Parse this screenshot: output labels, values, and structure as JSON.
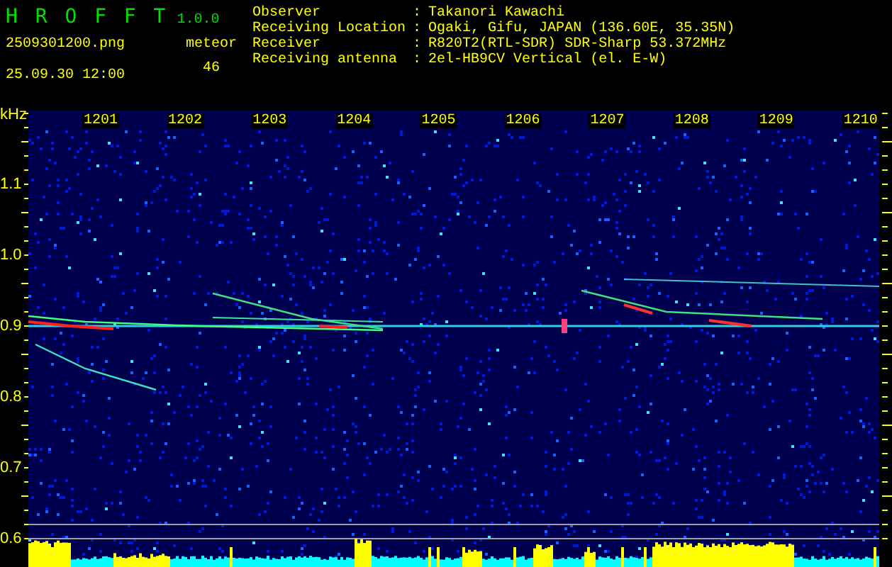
{
  "app": {
    "name": "H R O F F T",
    "version": "1.0.0"
  },
  "file": "2509301200.png",
  "datetime": "25.09.30 12:00",
  "count": {
    "label": "meteor",
    "value": "46"
  },
  "info": [
    {
      "label": "Observer",
      "separator": ":",
      "value": "Takanori Kawachi"
    },
    {
      "label": "Receiving Location",
      "separator": ":",
      "value": "Ogaki, Gifu, JAPAN (136.60E, 35.35N)"
    },
    {
      "label": "Receiver",
      "separator": ":",
      "value": "R820T2(RTL-SDR) SDR-Sharp 53.372MHz"
    },
    {
      "label": "Receiving antenna",
      "separator": ":",
      "value": "2el-HB9CV Vertical (el. E-W)"
    }
  ],
  "spectrogram": {
    "unit": "kHz",
    "time_labels": [
      "1201",
      "1202",
      "1203",
      "1204",
      "1205",
      "1206",
      "1207",
      "1208",
      "1209",
      "1210"
    ],
    "freq_labels": [
      "1.1",
      "1.0",
      "0.9",
      "0.8",
      "0.7",
      "0.6"
    ]
  }
}
